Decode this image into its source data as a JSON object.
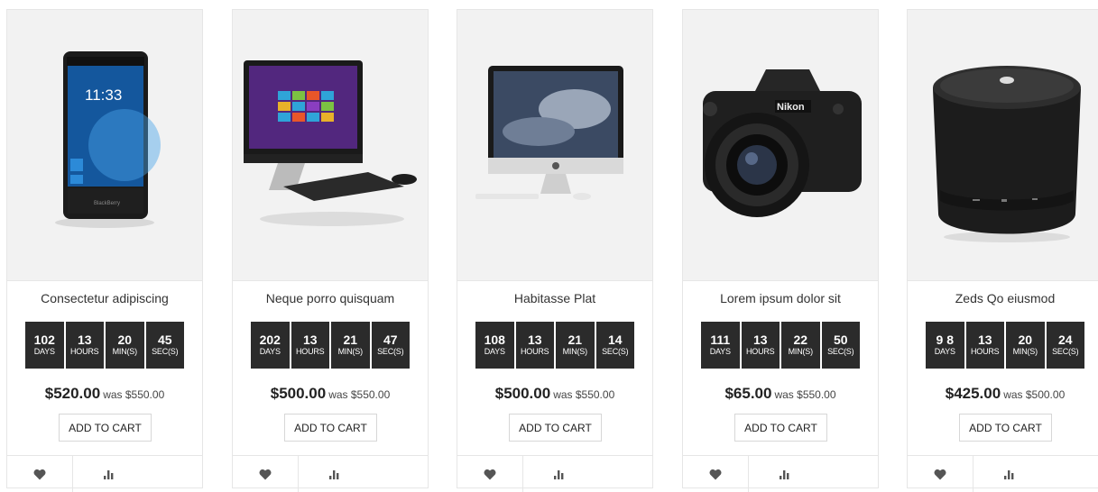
{
  "products": [
    {
      "name": "Consectetur adipiscing",
      "image": "smartphone",
      "timer": [
        {
          "value": "102",
          "unit": "DAYS"
        },
        {
          "value": "13",
          "unit": "HOURS"
        },
        {
          "value": "20",
          "unit": "MIN(S)"
        },
        {
          "value": "45",
          "unit": "SEC(S)"
        }
      ],
      "price": "$520.00",
      "was": "was $550.00",
      "cart_label": "ADD TO CART"
    },
    {
      "name": "Neque porro quisquam",
      "image": "all-in-one-pc",
      "timer": [
        {
          "value": "202",
          "unit": "DAYS"
        },
        {
          "value": "13",
          "unit": "HOURS"
        },
        {
          "value": "21",
          "unit": "MIN(S)"
        },
        {
          "value": "47",
          "unit": "SEC(S)"
        }
      ],
      "price": "$500.00",
      "was": "was $550.00",
      "cart_label": "ADD TO CART"
    },
    {
      "name": "Habitasse Plat",
      "image": "imac",
      "timer": [
        {
          "value": "108",
          "unit": "DAYS"
        },
        {
          "value": "13",
          "unit": "HOURS"
        },
        {
          "value": "21",
          "unit": "MIN(S)"
        },
        {
          "value": "14",
          "unit": "SEC(S)"
        }
      ],
      "price": "$500.00",
      "was": "was $550.00",
      "cart_label": "ADD TO CART"
    },
    {
      "name": "Lorem ipsum dolor sit",
      "image": "dslr-camera",
      "timer": [
        {
          "value": "111",
          "unit": "DAYS"
        },
        {
          "value": "13",
          "unit": "HOURS"
        },
        {
          "value": "22",
          "unit": "MIN(S)"
        },
        {
          "value": "50",
          "unit": "SEC(S)"
        }
      ],
      "price": "$65.00",
      "was": "was $550.00",
      "cart_label": "ADD TO CART"
    },
    {
      "name": "Zeds Qo eiusmod",
      "image": "bluetooth-speaker",
      "timer": [
        {
          "value": "9 8",
          "unit": "DAYS"
        },
        {
          "value": "13",
          "unit": "HOURS"
        },
        {
          "value": "20",
          "unit": "MIN(S)"
        },
        {
          "value": "24",
          "unit": "SEC(S)"
        }
      ],
      "price": "$425.00",
      "was": "was $500.00",
      "cart_label": "ADD TO CART"
    }
  ],
  "icons": {
    "wishlist": "heart-icon",
    "compare": "compare-icon"
  },
  "colors": {
    "timer_bg": "#2b2b2b",
    "image_bg": "#f2f2f2",
    "icon": "#555555"
  }
}
